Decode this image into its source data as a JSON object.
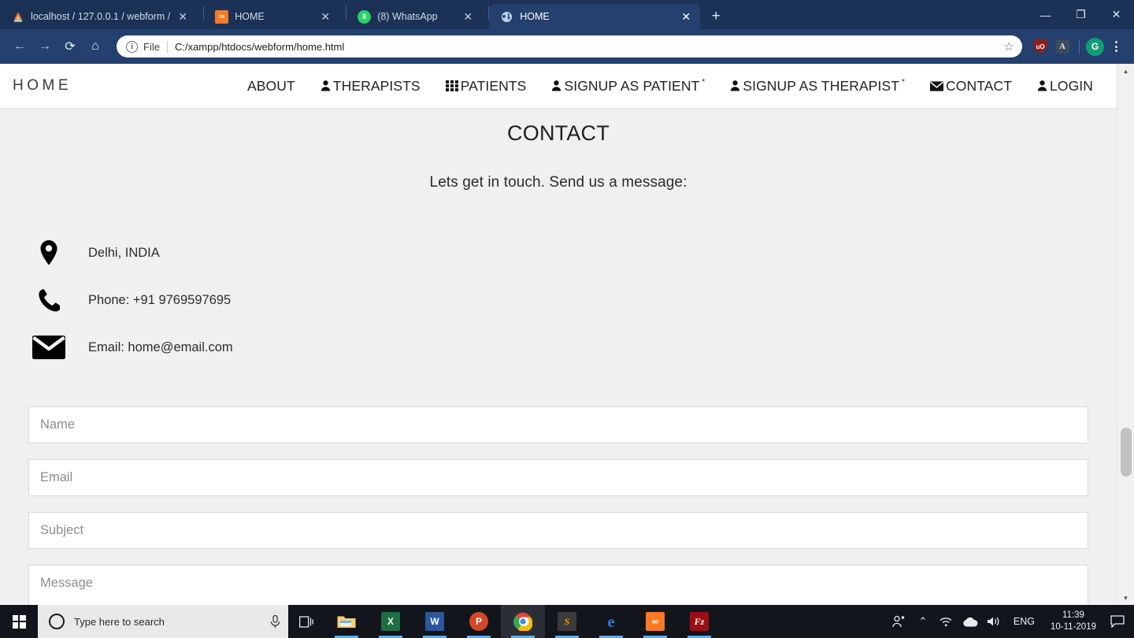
{
  "browser": {
    "tabs": [
      {
        "title": "localhost / 127.0.0.1 / webform /",
        "favicon": "phpmyadmin-icon",
        "active": false
      },
      {
        "title": "HOME",
        "favicon": "xampp-icon",
        "active": false
      },
      {
        "title": "(8) WhatsApp",
        "favicon": "whatsapp-icon",
        "active": false
      },
      {
        "title": "HOME",
        "favicon": "globe-icon",
        "active": true
      }
    ],
    "new_tab_label": "+",
    "close_label": "✕",
    "window_controls": {
      "minimize": "—",
      "maximize": "❐",
      "close": "✕"
    },
    "nav": {
      "back": "←",
      "forward": "→",
      "reload": "⟳",
      "home": "⌂"
    },
    "omnibox": {
      "info_glyph": "i",
      "scheme_label": "File",
      "url": "C:/xampp/htdocs/webform/home.html",
      "star": "☆"
    },
    "extensions": [
      {
        "name": "ublock-origin-icon",
        "label": "uO"
      },
      {
        "name": "adobe-acrobat-icon",
        "label": "A"
      }
    ],
    "profile_initial": "G"
  },
  "site": {
    "brand": "HOME",
    "nav_items": [
      {
        "label": "ABOUT",
        "icon": ""
      },
      {
        "label": "THERAPISTS",
        "icon": "user-icon"
      },
      {
        "label": "PATIENTS",
        "icon": "grid-icon"
      },
      {
        "label": "SIGNUP AS PATIENT",
        "icon": "user-icon",
        "sup": "*"
      },
      {
        "label": "SIGNUP AS THERAPIST",
        "icon": "user-icon",
        "sup": "*"
      },
      {
        "label": "CONTACT",
        "icon": "envelope-icon"
      },
      {
        "label": "LOGIN",
        "icon": "user-icon"
      }
    ]
  },
  "main": {
    "title": "CONTACT",
    "subtitle": "Lets get in touch. Send us a message:",
    "contact_info": [
      {
        "icon": "map-pin-icon",
        "text": "Delhi, INDIA"
      },
      {
        "icon": "phone-icon",
        "text": "Phone: +91 9769597695"
      },
      {
        "icon": "envelope-icon",
        "text": "Email: home@email.com"
      }
    ],
    "form": {
      "fields": [
        {
          "name": "name-field",
          "placeholder": "Name",
          "value": ""
        },
        {
          "name": "email-field",
          "placeholder": "Email",
          "value": ""
        },
        {
          "name": "subject-field",
          "placeholder": "Subject",
          "value": ""
        }
      ],
      "message": {
        "name": "message-field",
        "placeholder": "Message",
        "value": ""
      }
    }
  },
  "scrollbar": {
    "up_arrow": "▲",
    "down_arrow": "▼"
  },
  "taskbar": {
    "search_placeholder": "Type here to search",
    "apps": [
      {
        "name": "file-explorer-icon",
        "label": "",
        "active": false
      },
      {
        "name": "excel-icon",
        "label": "X",
        "active": false
      },
      {
        "name": "word-icon",
        "label": "W",
        "active": false
      },
      {
        "name": "powerpoint-icon",
        "label": "P",
        "active": false
      },
      {
        "name": "chrome-icon",
        "label": "",
        "active": true
      },
      {
        "name": "sublime-text-icon",
        "label": "S",
        "active": false
      },
      {
        "name": "edge-icon",
        "label": "e",
        "active": false
      },
      {
        "name": "xampp-icon",
        "label": "∞",
        "active": false
      },
      {
        "name": "filezilla-icon",
        "label": "Fz",
        "active": false
      }
    ],
    "tray": {
      "people": "people-icon",
      "chevron": "⌃",
      "network": "wifi-icon",
      "onedrive": "cloud-icon",
      "volume": "speaker-icon",
      "language": "ENG",
      "time": "11:39",
      "date": "10-11-2019",
      "notifications": "notification-icon"
    }
  }
}
